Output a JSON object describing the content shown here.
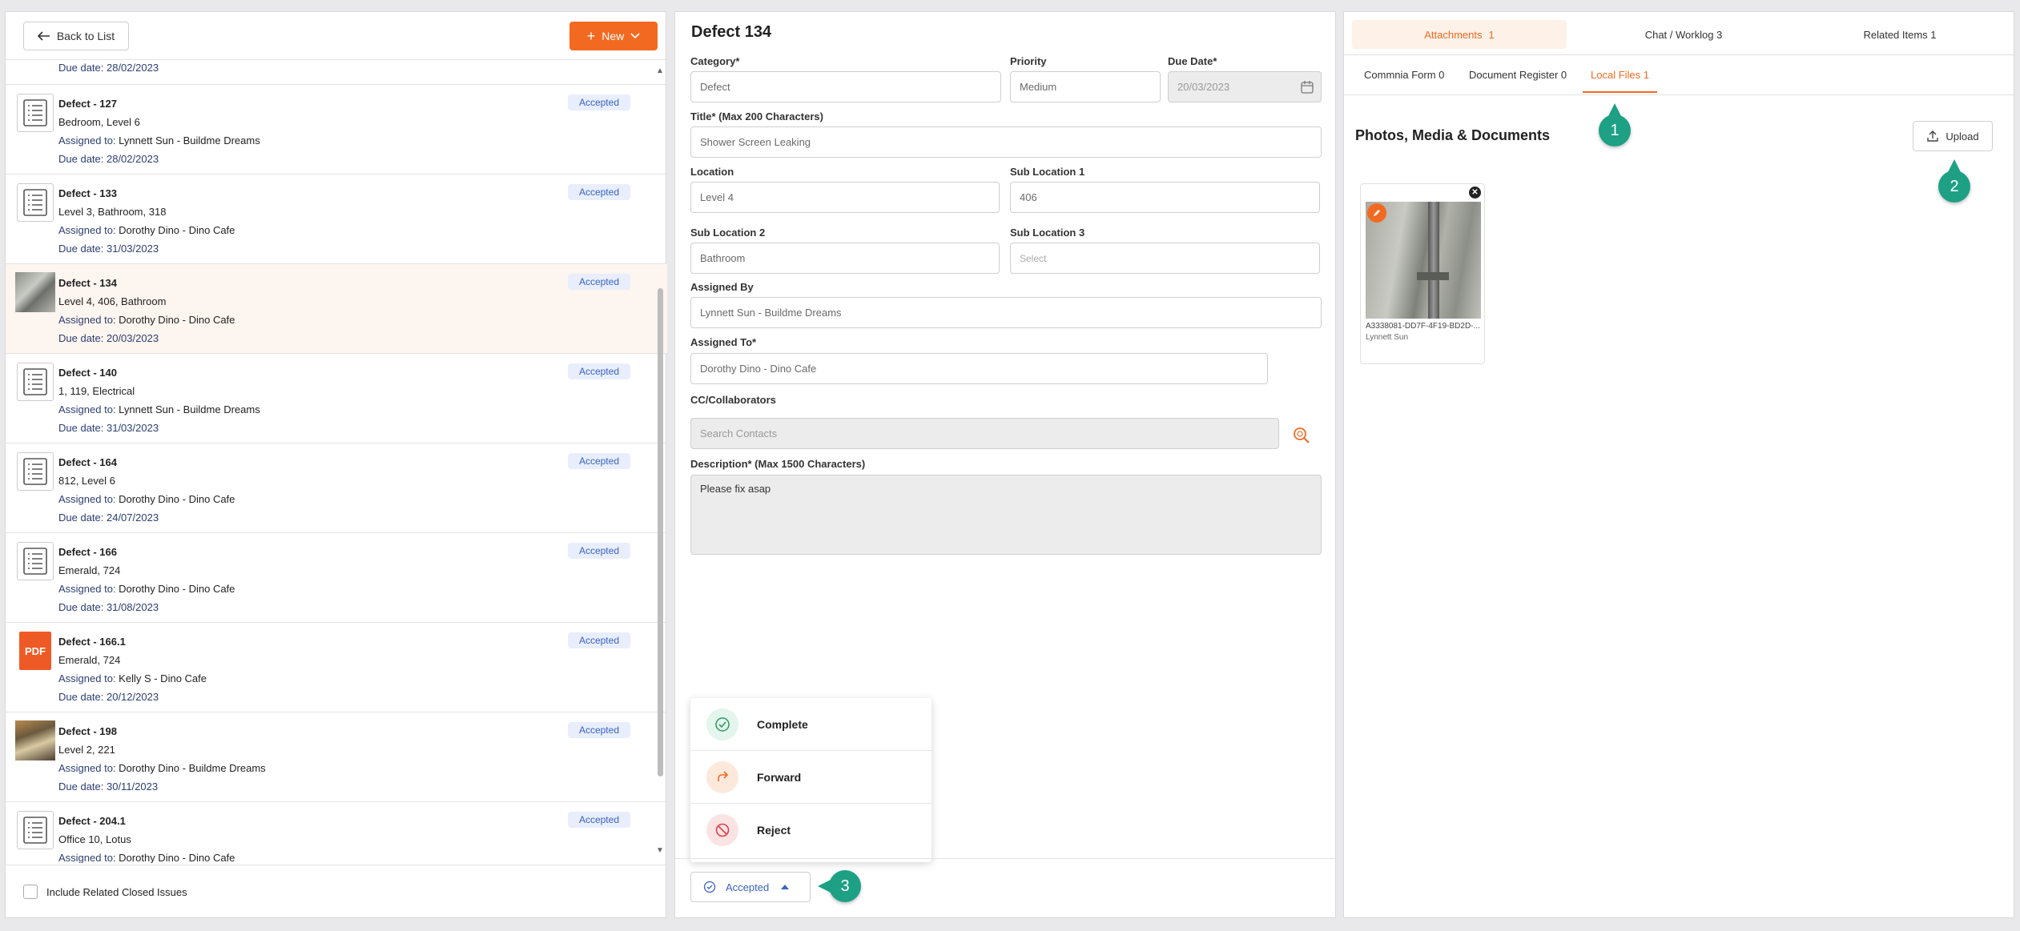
{
  "left": {
    "back_label": "Back to List",
    "new_label": "New",
    "first_due": "Due date: 28/02/2023",
    "items": [
      {
        "title": "Defect - 127",
        "location": "Bedroom, Level 6",
        "assigned_prefix": "Assigned to:",
        "assigned": "Lynnett Sun - Buildme Dreams",
        "due": "Due date: 28/02/2023",
        "status": "Accepted",
        "thumb": "list-icon"
      },
      {
        "title": "Defect - 133",
        "location": "Level 3, Bathroom, 318",
        "assigned_prefix": "Assigned to:",
        "assigned": "Dorothy Dino - Dino Cafe",
        "due": "Due date: 31/03/2023",
        "status": "Accepted",
        "thumb": "list-icon"
      },
      {
        "title": "Defect - 134",
        "location": "Level 4, 406, Bathroom",
        "assigned_prefix": "Assigned to:",
        "assigned": "Dorothy Dino - Dino Cafe",
        "due": "Due date: 20/03/2023",
        "status": "Accepted",
        "thumb": "photo"
      },
      {
        "title": "Defect - 140",
        "location": "1, 119, Electrical",
        "assigned_prefix": "Assigned to:",
        "assigned": "Lynnett Sun - Buildme Dreams",
        "due": "Due date: 31/03/2023",
        "status": "Accepted",
        "thumb": "list-icon"
      },
      {
        "title": "Defect - 164",
        "location": "812, Level 6",
        "assigned_prefix": "Assigned to:",
        "assigned": "Dorothy Dino - Dino Cafe",
        "due": "Due date: 24/07/2023",
        "status": "Accepted",
        "thumb": "list-icon"
      },
      {
        "title": "Defect - 166",
        "location": "Emerald, 724",
        "assigned_prefix": "Assigned to:",
        "assigned": "Dorothy Dino - Dino Cafe",
        "due": "Due date: 31/08/2023",
        "status": "Accepted",
        "thumb": "list-icon"
      },
      {
        "title": "Defect - 166.1",
        "location": "Emerald, 724",
        "assigned_prefix": "Assigned to:",
        "assigned": "Kelly S - Dino Cafe",
        "due": "Due date: 20/12/2023",
        "status": "Accepted",
        "thumb": "pdf"
      },
      {
        "title": "Defect - 198",
        "location": "Level 2, 221",
        "assigned_prefix": "Assigned to:",
        "assigned": "Dorothy Dino - Buildme Dreams",
        "due": "Due date: 30/11/2023",
        "status": "Accepted",
        "thumb": "photo2"
      },
      {
        "title": "Defect - 204.1",
        "location": "Office 10, Lotus",
        "assigned_prefix": "Assigned to:",
        "assigned": "Dorothy Dino - Dino Cafe",
        "due": "",
        "status": "Accepted",
        "thumb": "list-icon"
      }
    ],
    "pdf_text": "PDF",
    "include_closed_label": "Include Related Closed Issues"
  },
  "form": {
    "title": "Defect 134",
    "category_label": "Category*",
    "category_value": "Defect",
    "priority_label": "Priority",
    "priority_value": "Medium",
    "due_label": "Due Date*",
    "due_value": "20/03/2023",
    "title_label": "Title* (Max 200 Characters)",
    "title_value": "Shower Screen Leaking",
    "location_label": "Location",
    "location_value": "Level 4",
    "sub1_label": "Sub Location 1",
    "sub1_value": "406",
    "sub2_label": "Sub Location 2",
    "sub2_value": "Bathroom",
    "sub3_label": "Sub Location 3",
    "sub3_placeholder": "Select",
    "assigned_by_label": "Assigned By",
    "assigned_by_value": "Lynnett Sun - Buildme Dreams",
    "assigned_to_label": "Assigned To*",
    "assigned_to_value": "Dorothy Dino - Dino Cafe",
    "cc_label": "CC/Collaborators",
    "cc_placeholder": "Search Contacts",
    "desc_label": "Description* (Max 1500 Characters)",
    "desc_value": "Please fix asap"
  },
  "actions": {
    "complete": "Complete",
    "forward": "Forward",
    "reject": "Reject",
    "status": "Accepted"
  },
  "callouts": {
    "one": "1",
    "two": "2",
    "three": "3"
  },
  "right": {
    "tab_attachments": "Attachments",
    "tab_attachments_count": "1",
    "tab_chat": "Chat / Worklog 3",
    "tab_related": "Related Items 1",
    "sub_commnia": "Commnia Form 0",
    "sub_docreg": "Document Register 0",
    "sub_local": "Local Files 1",
    "section_title": "Photos, Media & Documents",
    "upload_label": "Upload",
    "file_name": "A3338081-DD7F-4F19-BD2D-...",
    "file_user": "Lynnett Sun"
  },
  "colors": {
    "accent": "#f26a21",
    "callout": "#1ea085",
    "badge_bg": "#e8eefb",
    "badge_text": "#3a63c4"
  }
}
